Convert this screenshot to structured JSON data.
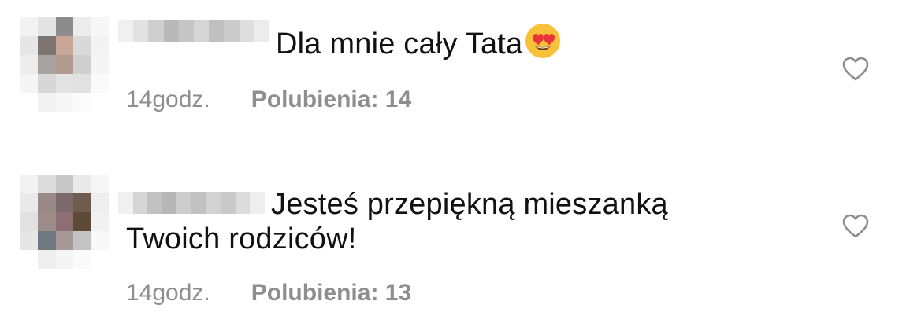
{
  "comments": [
    {
      "text_line1": "Dla mnie cały Tata",
      "text_line2": "",
      "emoji": "heart-eyes-emoji",
      "time": "14godz.",
      "likes": "Polubienia: 14"
    },
    {
      "text_line1": "Jesteś przepiękną mieszanką",
      "text_line2": "Twoich rodziców!",
      "emoji": "",
      "time": "14godz.",
      "likes": "Polubienia: 13"
    }
  ],
  "colors": {
    "meta_gray": "#8e8e8e",
    "heart_stroke": "#8e8e8e",
    "emoji_face": "#f7c23a",
    "emoji_heart": "#e8343a"
  },
  "icons": {
    "like": "heart-outline-icon",
    "avatar": "blurred-avatar",
    "username": "blurred-username"
  }
}
